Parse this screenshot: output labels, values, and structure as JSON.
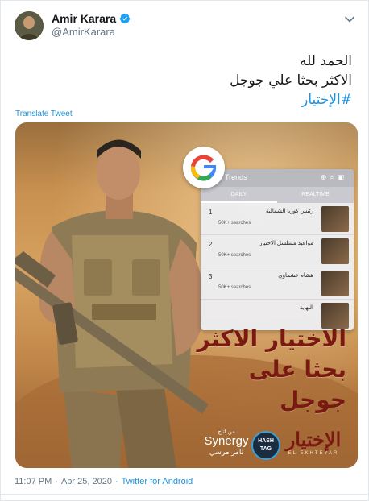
{
  "author": {
    "name": "Amir Karara",
    "handle": "@AmirKarara",
    "verified": true
  },
  "tweet": {
    "line1": "الحمد لله",
    "line2": "الاكثر بحثا علي جوجل",
    "hashtag": "#الإختيار",
    "translate_label": "Translate Tweet"
  },
  "media": {
    "overlay_line1": "الاختيار الاكثر",
    "overlay_line2": "بحثا على",
    "overlay_line3": "جوجل",
    "trends_panel": {
      "title": "Trends",
      "tab_daily": "DAILY",
      "tab_realtime": "REALTIME",
      "items": [
        {
          "rank": "1",
          "title": "رئيس كوريا الشمالية",
          "searches": "50K+ searches"
        },
        {
          "rank": "2",
          "title": "مواعيد مسلسل الاختيار",
          "searches": "50K+ searches"
        },
        {
          "rank": "3",
          "title": "هشام عشماوي",
          "searches": "50K+ searches"
        },
        {
          "rank": "",
          "title": "النهاية",
          "searches": ""
        }
      ]
    },
    "credit_top": "من اتاج",
    "credit_brand": "Synergy",
    "credit_name": "تامر مرسي",
    "hashtag_logo_line1": "HASH",
    "hashtag_logo_line2": "TAG",
    "show_title_ar": "الإختيار",
    "show_title_en": "EL EKHTEYAR"
  },
  "meta": {
    "time": "11:07 PM",
    "separator": "·",
    "date": "Apr 25, 2020",
    "separator2": "·",
    "client": "Twitter for Android"
  },
  "colors": {
    "link": "#1b95e0",
    "verified": "#1da1f2",
    "secondary_text": "#657786",
    "overlay_red": "#7a1812"
  },
  "icons": {
    "verified": "verified-badge-icon",
    "caret": "chevron-down-icon",
    "google": "google-logo-icon"
  }
}
